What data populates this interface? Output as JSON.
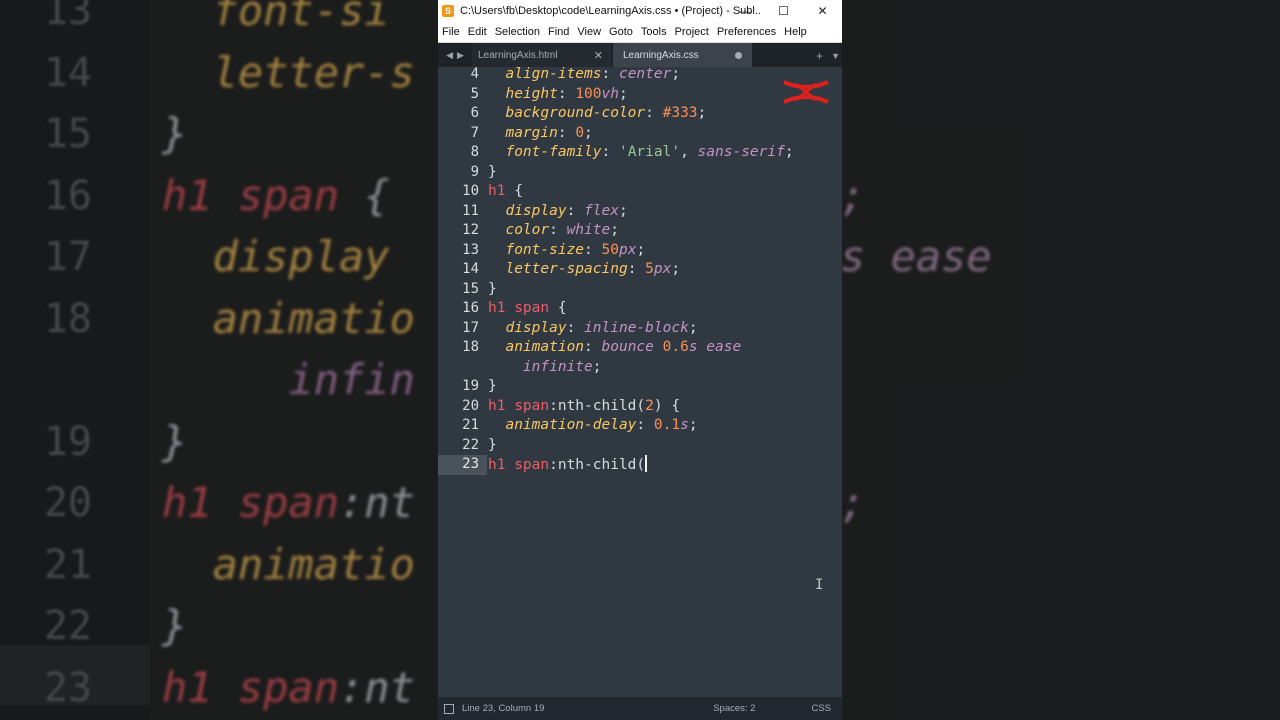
{
  "window": {
    "title": "C:\\Users\\fb\\Desktop\\code\\LearningAxis.css • (Project) - Subl...",
    "app_icon": "sublime-text-icon",
    "controls": [
      "—",
      "☐",
      "✕"
    ]
  },
  "menu": [
    "File",
    "Edit",
    "Selection",
    "Find",
    "View",
    "Goto",
    "Tools",
    "Project",
    "Preferences",
    "Help"
  ],
  "tabs": [
    {
      "label": "LearningAxis.html",
      "active": false
    },
    {
      "label": "LearningAxis.css",
      "active": true,
      "modified": true
    }
  ],
  "code_lines": [
    {
      "n": "4",
      "tokens": [
        [
          "prop",
          "  align-items"
        ],
        [
          "pun",
          ": "
        ],
        [
          "val",
          "center"
        ],
        [
          "pun",
          ";"
        ]
      ]
    },
    {
      "n": "5",
      "tokens": [
        [
          "prop",
          "  height"
        ],
        [
          "pun",
          ": "
        ],
        [
          "num",
          "100"
        ],
        [
          "val",
          "vh"
        ],
        [
          "pun",
          ";"
        ]
      ]
    },
    {
      "n": "6",
      "tokens": [
        [
          "prop",
          "  background-color"
        ],
        [
          "pun",
          ": "
        ],
        [
          "num",
          "#333"
        ],
        [
          "pun",
          ";"
        ]
      ]
    },
    {
      "n": "7",
      "tokens": [
        [
          "prop",
          "  margin"
        ],
        [
          "pun",
          ": "
        ],
        [
          "num",
          "0"
        ],
        [
          "pun",
          ";"
        ]
      ]
    },
    {
      "n": "8",
      "tokens": [
        [
          "prop",
          "  font-family"
        ],
        [
          "pun",
          ": "
        ],
        [
          "str",
          "'Arial'"
        ],
        [
          "pun",
          ", "
        ],
        [
          "val",
          "sans-serif"
        ],
        [
          "pun",
          ";"
        ]
      ]
    },
    {
      "n": "9",
      "tokens": [
        [
          "pun",
          "}"
        ]
      ]
    },
    {
      "n": "10",
      "tokens": [
        [
          "sel",
          "h1"
        ],
        [
          "pun",
          " {"
        ]
      ]
    },
    {
      "n": "11",
      "tokens": [
        [
          "prop",
          "  display"
        ],
        [
          "pun",
          ": "
        ],
        [
          "val",
          "flex"
        ],
        [
          "pun",
          ";"
        ]
      ]
    },
    {
      "n": "12",
      "tokens": [
        [
          "prop",
          "  color"
        ],
        [
          "pun",
          ": "
        ],
        [
          "val",
          "white"
        ],
        [
          "pun",
          ";"
        ]
      ]
    },
    {
      "n": "13",
      "tokens": [
        [
          "prop",
          "  font-size"
        ],
        [
          "pun",
          ": "
        ],
        [
          "num",
          "50"
        ],
        [
          "val",
          "px"
        ],
        [
          "pun",
          ";"
        ]
      ]
    },
    {
      "n": "14",
      "tokens": [
        [
          "prop",
          "  letter-spacing"
        ],
        [
          "pun",
          ": "
        ],
        [
          "num",
          "5"
        ],
        [
          "val",
          "px"
        ],
        [
          "pun",
          ";"
        ]
      ]
    },
    {
      "n": "15",
      "tokens": [
        [
          "pun",
          "}"
        ]
      ]
    },
    {
      "n": "16",
      "tokens": [
        [
          "sel",
          "h1 span"
        ],
        [
          "pun",
          " {"
        ]
      ]
    },
    {
      "n": "17",
      "tokens": [
        [
          "prop",
          "  display"
        ],
        [
          "pun",
          ": "
        ],
        [
          "val",
          "inline-block"
        ],
        [
          "pun",
          ";"
        ]
      ]
    },
    {
      "n": "18",
      "tokens": [
        [
          "prop",
          "  animation"
        ],
        [
          "pun",
          ": "
        ],
        [
          "val",
          "bounce "
        ],
        [
          "num",
          "0.6"
        ],
        [
          "val",
          "s ease"
        ]
      ]
    },
    {
      "n": "",
      "tokens": [
        [
          "val",
          "    infinite"
        ],
        [
          "pun",
          ";"
        ]
      ]
    },
    {
      "n": "19",
      "tokens": [
        [
          "pun",
          "}"
        ]
      ]
    },
    {
      "n": "20",
      "tokens": [
        [
          "sel",
          "h1 span"
        ],
        [
          "plain",
          ":nth-child("
        ],
        [
          "num",
          "2"
        ],
        [
          "plain",
          ")"
        ],
        [
          "pun",
          " {"
        ]
      ]
    },
    {
      "n": "21",
      "tokens": [
        [
          "prop",
          "  animation-delay"
        ],
        [
          "pun",
          ": "
        ],
        [
          "num",
          "0.1"
        ],
        [
          "val",
          "s"
        ],
        [
          "pun",
          ";"
        ]
      ]
    },
    {
      "n": "22",
      "tokens": [
        [
          "pun",
          "}"
        ]
      ]
    },
    {
      "n": "23",
      "tokens": [
        [
          "sel",
          "h1 span"
        ],
        [
          "plain",
          ":nth-child("
        ]
      ],
      "current": true
    }
  ],
  "status": {
    "position": "Line 23, Column 19",
    "spaces": "Spaces: 2",
    "syntax": "CSS"
  },
  "background": {
    "numbers": [
      "13",
      "14",
      "15",
      "16",
      "17",
      "18",
      "",
      "19",
      "20",
      "21",
      "22",
      "23"
    ],
    "lines": [
      [
        [
          "prop",
          "  font-si"
        ]
      ],
      [
        [
          "prop",
          "  letter-s"
        ]
      ],
      [
        [
          "pun",
          "}"
        ]
      ],
      [
        [
          "sel",
          "h1 span"
        ],
        [
          "pun",
          " {"
        ]
      ],
      [
        [
          "prop",
          "  display"
        ]
      ],
      [
        [
          "prop",
          "  animatio"
        ]
      ],
      [
        [
          "val",
          "     infin"
        ]
      ],
      [
        [
          "pun",
          "}"
        ]
      ],
      [
        [
          "sel",
          "h1 span"
        ],
        [
          "plain",
          ":nt"
        ]
      ],
      [
        [
          "prop",
          "  animatio"
        ]
      ],
      [
        [
          "pun",
          "}"
        ]
      ],
      [
        [
          "sel",
          "h1 span"
        ],
        [
          "plain",
          ":nt"
        ]
      ]
    ],
    "right_fragments": [
      {
        "text": ";",
        "row": 3
      },
      {
        "text": "s ease",
        "row": 4
      },
      {
        "text": ";",
        "row": 8
      }
    ]
  },
  "colors": {
    "editor_bg": "#303841",
    "selector": "#ec5f67",
    "property": "#fac863",
    "value": "#c594c5",
    "number": "#f99157",
    "string": "#99c794"
  }
}
